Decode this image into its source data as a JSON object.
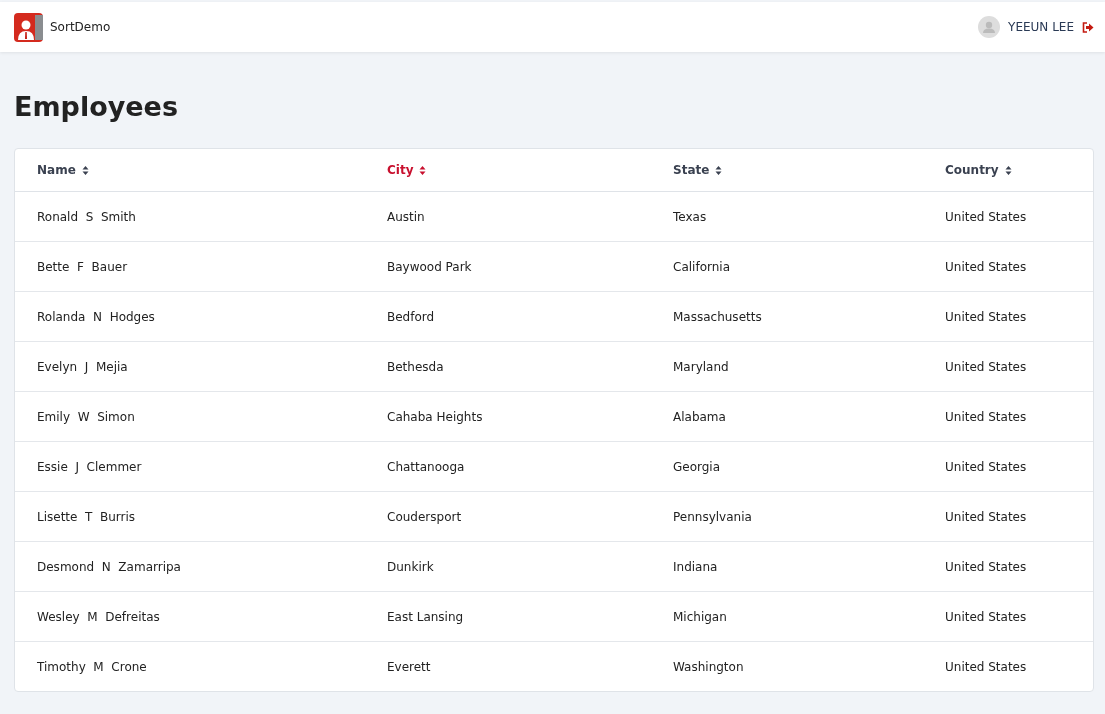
{
  "app": {
    "title": "SortDemo"
  },
  "user": {
    "name": "YEEUN LEE"
  },
  "page": {
    "title": "Employees"
  },
  "table": {
    "columns": [
      {
        "label": "Name",
        "selected": false
      },
      {
        "label": "City",
        "selected": true
      },
      {
        "label": "State",
        "selected": false
      },
      {
        "label": "Country",
        "selected": false
      }
    ],
    "rows": [
      [
        "Ronald  S  Smith",
        "Austin",
        "Texas",
        "United States"
      ],
      [
        "Bette  F  Bauer",
        "Baywood Park",
        "California",
        "United States"
      ],
      [
        "Rolanda  N  Hodges",
        "Bedford",
        "Massachusetts",
        "United States"
      ],
      [
        "Evelyn  J  Mejia",
        "Bethesda",
        "Maryland",
        "United States"
      ],
      [
        "Emily  W  Simon",
        "Cahaba Heights",
        "Alabama",
        "United States"
      ],
      [
        "Essie  J  Clemmer",
        "Chattanooga",
        "Georgia",
        "United States"
      ],
      [
        "Lisette  T  Burris",
        "Coudersport",
        "Pennsylvania",
        "United States"
      ],
      [
        "Desmond  N  Zamarripa",
        "Dunkirk",
        "Indiana",
        "United States"
      ],
      [
        "Wesley  M  Defreitas",
        "East Lansing",
        "Michigan",
        "United States"
      ],
      [
        "Timothy  M  Crone",
        "Everett",
        "Washington",
        "United States"
      ]
    ]
  }
}
